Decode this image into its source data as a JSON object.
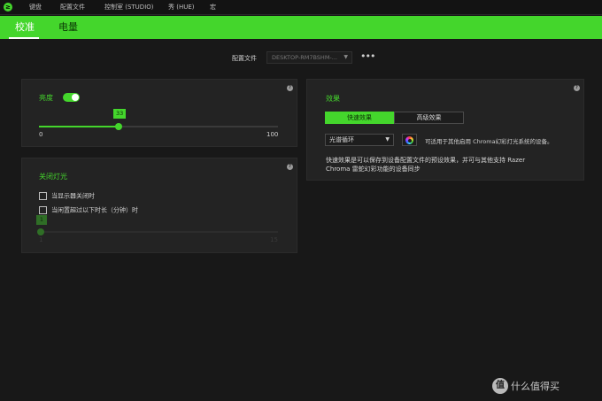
{
  "topnav": {
    "logo_glyph": "≥",
    "items": [
      "键盘",
      "配置文件",
      "控制室 (STUDIO)",
      "秀 (HUE)",
      "宏"
    ]
  },
  "tabs": [
    "校准",
    "电量"
  ],
  "profile": {
    "label": "配置文件",
    "value": "DESKTOP-RM7BSHM-...",
    "more": "•••"
  },
  "brightness": {
    "title": "亮度",
    "toggle_on": true,
    "value": "33",
    "min": "0",
    "max": "100"
  },
  "lights_off": {
    "title": "关闭灯光",
    "options": [
      "当显示器关闭时",
      "当闲置超过以下时长（分钟）时"
    ],
    "slider_value": "1",
    "min": "1",
    "max": "15"
  },
  "effects": {
    "title": "效果",
    "segments": [
      "快速效果",
      "高级效果"
    ],
    "selected_effect": "光谱循环",
    "chroma_note": "可适用于其他启用 Chroma幻彩灯光系统的设备。",
    "description": "快速效果是可以保存到设备配置文件的预设效果，并可与其他支持 Razer Chroma 雷蛇幻彩功能的设备同步"
  },
  "info_glyph": "?",
  "watermark": {
    "badge": "值",
    "text": "什么值得买"
  },
  "colors": {
    "accent": "#44d62c",
    "background": "#181818",
    "panel": "#232323"
  }
}
